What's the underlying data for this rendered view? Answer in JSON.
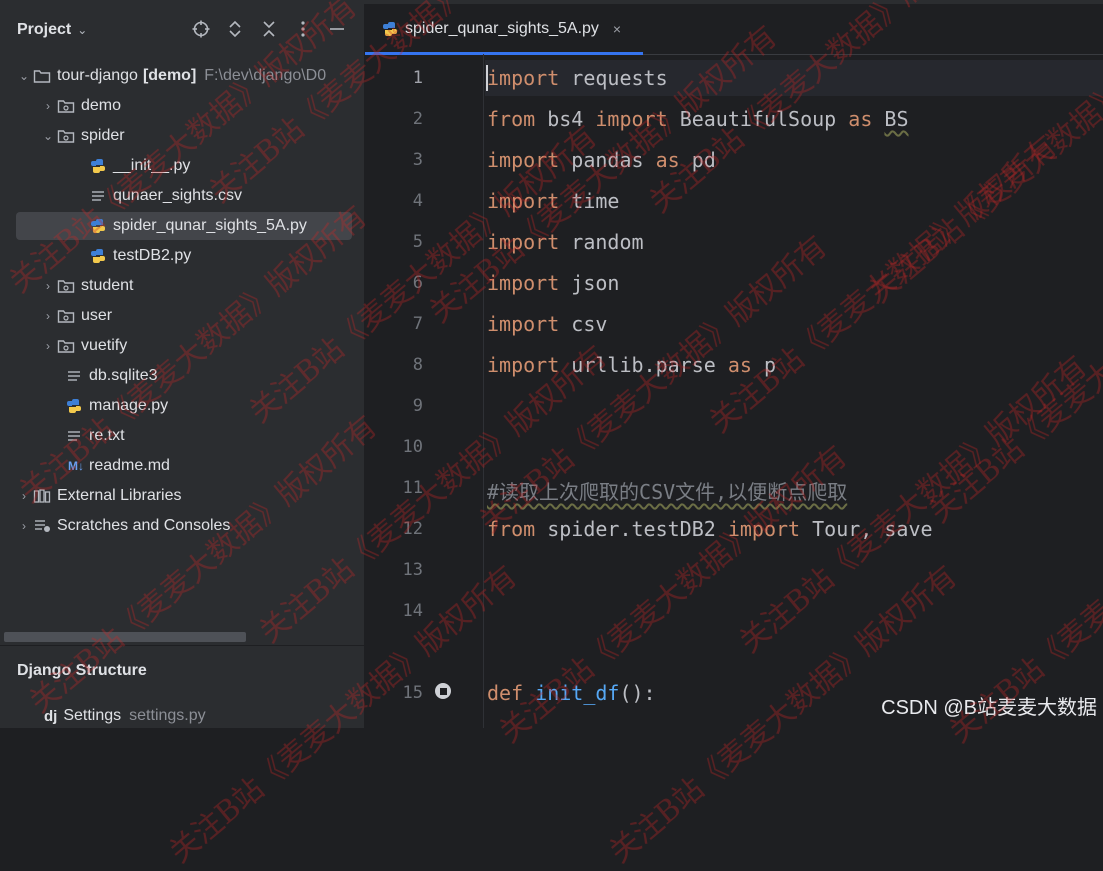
{
  "project_panel": {
    "title": "Project",
    "tree": [
      {
        "label": "tour-django",
        "badge": "[demo]",
        "path": "F:\\dev\\django\\D0",
        "icon": "folder-icon",
        "expanded": true
      },
      {
        "label": "demo",
        "icon": "package-folder-icon"
      },
      {
        "label": "spider",
        "icon": "package-folder-icon",
        "expanded": true
      },
      {
        "label": "__init__.py",
        "icon": "python-file-icon"
      },
      {
        "label": "qunaer_sights.csv",
        "icon": "text-file-icon"
      },
      {
        "label": "spider_qunar_sights_5A.py",
        "icon": "python-file-icon",
        "selected": true
      },
      {
        "label": "testDB2.py",
        "icon": "python-file-icon"
      },
      {
        "label": "student",
        "icon": "package-folder-icon"
      },
      {
        "label": "user",
        "icon": "package-folder-icon"
      },
      {
        "label": "vuetify",
        "icon": "package-folder-icon"
      },
      {
        "label": "db.sqlite3",
        "icon": "text-file-icon"
      },
      {
        "label": "manage.py",
        "icon": "python-file-icon"
      },
      {
        "label": "re.txt",
        "icon": "text-file-icon"
      },
      {
        "label": "readme.md",
        "icon": "markdown-file-icon",
        "icon_text": "M↓"
      },
      {
        "label": "External Libraries",
        "icon": "library-icon"
      },
      {
        "label": "Scratches and Consoles",
        "icon": "scratches-icon"
      }
    ]
  },
  "django_structure": {
    "title": "Django Structure",
    "item_icon_text": "dj",
    "item_label": "Settings",
    "item_file": "settings.py"
  },
  "editor": {
    "tab_label": "spider_qunar_sights_5A.py",
    "tab_close": "×",
    "line_numbers": [
      "1",
      "2",
      "3",
      "4",
      "5",
      "6",
      "7",
      "8",
      "9",
      "10",
      "11",
      "12",
      "13",
      "14",
      "15"
    ],
    "lines": [
      [
        [
          "kw",
          "import"
        ],
        [
          "",
          "requests"
        ]
      ],
      [
        [
          "kw",
          "from"
        ],
        [
          "",
          "bs4"
        ],
        [
          "kw",
          "import"
        ],
        [
          "",
          "BeautifulSoup"
        ],
        [
          "kw",
          "as"
        ],
        [
          "w",
          "BS"
        ]
      ],
      [
        [
          "kw",
          "import"
        ],
        [
          "",
          "pandas"
        ],
        [
          "kw",
          "as"
        ],
        [
          "",
          "pd"
        ]
      ],
      [
        [
          "kw",
          "import"
        ],
        [
          "",
          "time"
        ]
      ],
      [
        [
          "kw",
          "import"
        ],
        [
          "",
          "random"
        ]
      ],
      [
        [
          "kw",
          "import"
        ],
        [
          "",
          "json"
        ]
      ],
      [
        [
          "kw",
          "import"
        ],
        [
          "",
          "csv"
        ]
      ],
      [
        [
          "kw",
          "import"
        ],
        [
          "",
          "urllib.parse"
        ],
        [
          "kw",
          "as"
        ],
        [
          "",
          "p"
        ]
      ],
      [],
      [],
      [
        [
          "cm",
          "#读取上次爬取的CSV文件,以便断点爬取"
        ]
      ],
      [
        [
          "kw",
          "from"
        ],
        [
          "",
          "spider.testDB2"
        ],
        [
          "kw",
          "import"
        ],
        [
          "",
          "Tour, save"
        ]
      ],
      [],
      [],
      [
        [
          "kw",
          "def"
        ],
        [
          "fn",
          "init_df"
        ],
        [
          "",
          "():"
        ]
      ]
    ]
  },
  "watermark": "CSDN @B站麦麦大数据",
  "watermark_repeat": "关注B站《麦麦大数据》版权所有",
  "colors": {
    "keyword": "#cf8e6d",
    "function": "#56a8f5",
    "comment": "#7a7e85",
    "accent": "#3574f0"
  }
}
